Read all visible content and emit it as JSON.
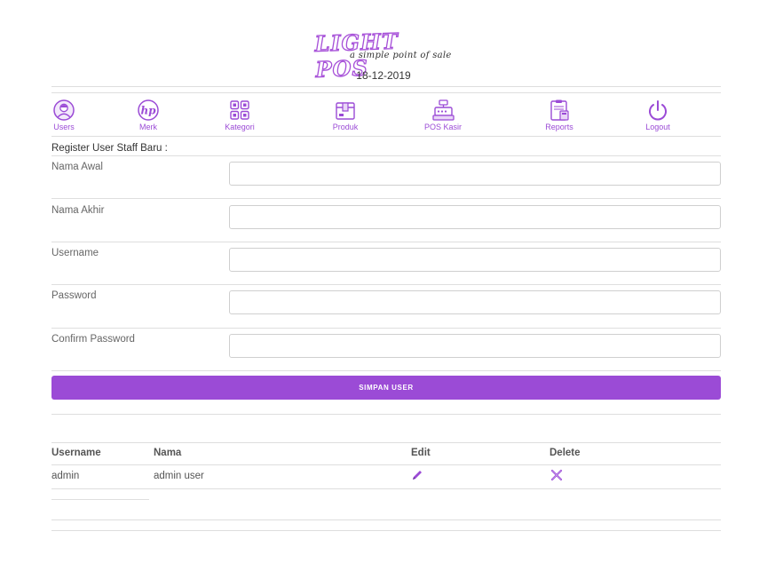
{
  "header": {
    "logo_title": "LIGHT POS",
    "logo_subtitle": "a simple point of sale",
    "date": "18-12-2019"
  },
  "colors": {
    "accent": "#9b4bd6",
    "divider": "#dedede"
  },
  "nav": {
    "items": [
      {
        "label": "Users",
        "icon": "user-avatar-icon"
      },
      {
        "label": "Merk",
        "icon": "hp-brand-icon"
      },
      {
        "label": "Kategori",
        "icon": "category-grid-icon"
      },
      {
        "label": "Produk",
        "icon": "product-box-icon"
      },
      {
        "label": "POS Kasir",
        "icon": "cash-register-icon"
      },
      {
        "label": "Reports",
        "icon": "report-clipboard-icon"
      },
      {
        "label": "Logout",
        "icon": "power-icon"
      }
    ]
  },
  "form": {
    "title": "Register User Staff Baru :",
    "fields": [
      {
        "label": "Nama Awal",
        "value": ""
      },
      {
        "label": "Nama Akhir",
        "value": ""
      },
      {
        "label": "Username",
        "value": ""
      },
      {
        "label": "Password",
        "value": ""
      },
      {
        "label": "Confirm Password",
        "value": ""
      }
    ],
    "submit_label": "SIMPAN USER"
  },
  "users_table": {
    "headers": {
      "username": "Username",
      "nama": "Nama",
      "edit": "Edit",
      "delete": "Delete"
    },
    "rows": [
      {
        "username": "admin",
        "nama": "admin user",
        "edit_icon": "pencil-icon",
        "delete_icon": "close-x-icon"
      }
    ]
  }
}
